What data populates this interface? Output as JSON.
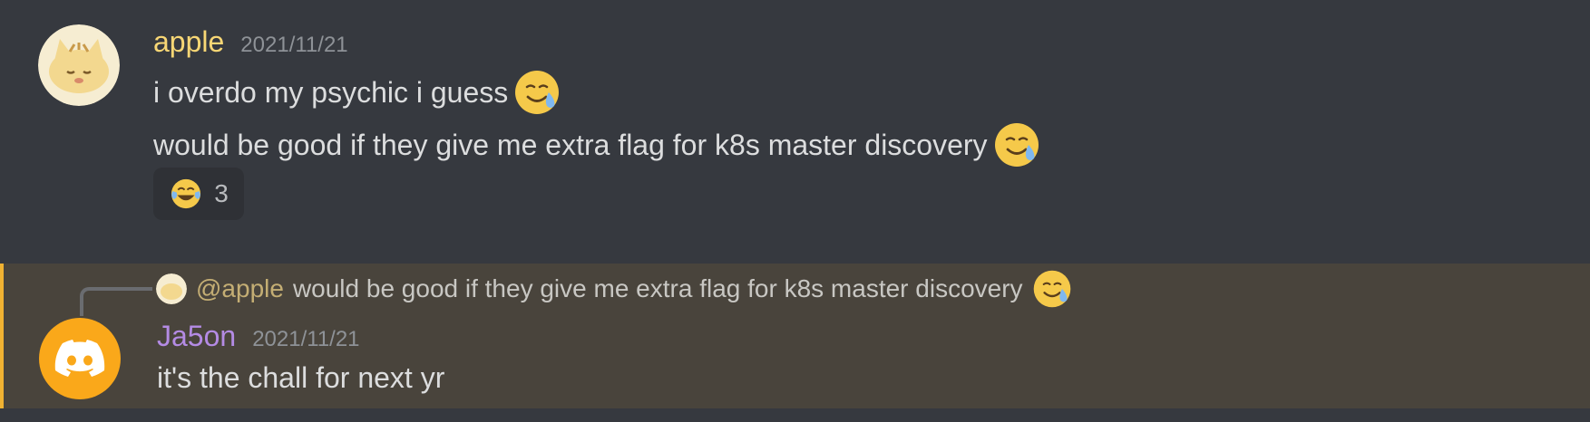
{
  "messages": [
    {
      "author": "apple",
      "timestamp": "2021/11/21",
      "lines": [
        "i overdo my psychic i guess",
        "would be good if they give me extra flag for k8s master discovery"
      ],
      "line_emojis": [
        "crying-smile-icon",
        "crying-smile-icon"
      ],
      "reaction": {
        "emoji": "tears-of-joy-icon",
        "count": "3"
      }
    },
    {
      "reply_to": {
        "mention": "@apple",
        "text": "would be good if they give me extra flag for k8s master discovery",
        "emoji": "crying-smile-icon"
      },
      "author": "Ja5on",
      "timestamp": "2021/11/21",
      "lines": [
        "it's the chall for next yr"
      ],
      "highlight_color": "#f0b232"
    }
  ],
  "colors": {
    "background": "#36393f",
    "mention_highlight_bg": "#49443c",
    "apple_name": "#f8d775",
    "jason_name": "#b48be4",
    "discord_avatar": "#faa81a"
  }
}
